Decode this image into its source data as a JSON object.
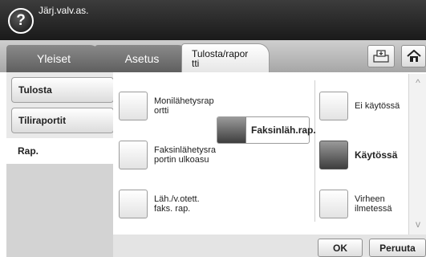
{
  "header": {
    "help_label": "?",
    "title": "Järj.valv.as."
  },
  "tabs": [
    {
      "label": "Yleiset"
    },
    {
      "label": "Asetus"
    },
    {
      "label_line1": "Tulosta/rapor",
      "label_line2": "tti",
      "active": true
    }
  ],
  "tab_icons": [
    "report-print-icon",
    "home-icon"
  ],
  "sidebar": {
    "items": [
      {
        "label": "Tulosta"
      },
      {
        "label": "Tiliraportit"
      },
      {
        "label": "Rap.",
        "active": true
      }
    ]
  },
  "options": {
    "multi_send": {
      "line1": "Monilähetysrap",
      "line2": "ortti",
      "checked": false
    },
    "fax_send_report": {
      "label": "Faksinläh.rap.",
      "selected": true
    },
    "disabled": {
      "label": "Ei käytössä",
      "checked": false
    },
    "fax_outside": {
      "line1": "Faksinlähetysra",
      "line2": "portin ulkoasu",
      "checked": false
    },
    "enabled": {
      "label": "Käytössä",
      "checked": true
    },
    "sent_received": {
      "line1": "Läh./v.otett.",
      "line2": "faks. rap.",
      "checked": false
    },
    "on_error": {
      "line1": "Virheen",
      "line2": "ilmetessä",
      "checked": false
    }
  },
  "scroll": {
    "up": "^",
    "down": "v"
  },
  "footer": {
    "ok_label": "OK",
    "cancel_label": "Peruuta"
  }
}
